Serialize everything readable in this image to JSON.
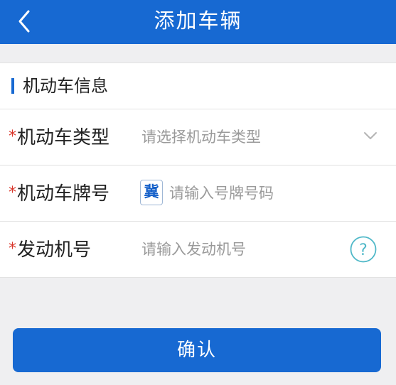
{
  "nav": {
    "title": "添加车辆",
    "back_icon": "chevron-left-icon"
  },
  "section": {
    "title": "机动车信息",
    "accent_color": "#1769d2"
  },
  "fields": [
    {
      "required_mark": "*",
      "label": "机动车类型",
      "placeholder": "请选择机动车类型",
      "trailing_icon": "chevron-down-icon"
    },
    {
      "required_mark": "*",
      "label": "机动车牌号",
      "province_prefix": "冀",
      "placeholder": "请输入号牌号码"
    },
    {
      "required_mark": "*",
      "label": "发动机号",
      "placeholder": "请输入发动机号",
      "trailing_icon": "help-icon"
    }
  ],
  "confirm_button": {
    "label": "确认"
  },
  "colors": {
    "primary": "#1769d2",
    "required": "#d9362b",
    "placeholder": "#9a9a9a",
    "help_icon": "#4fb8c8"
  }
}
